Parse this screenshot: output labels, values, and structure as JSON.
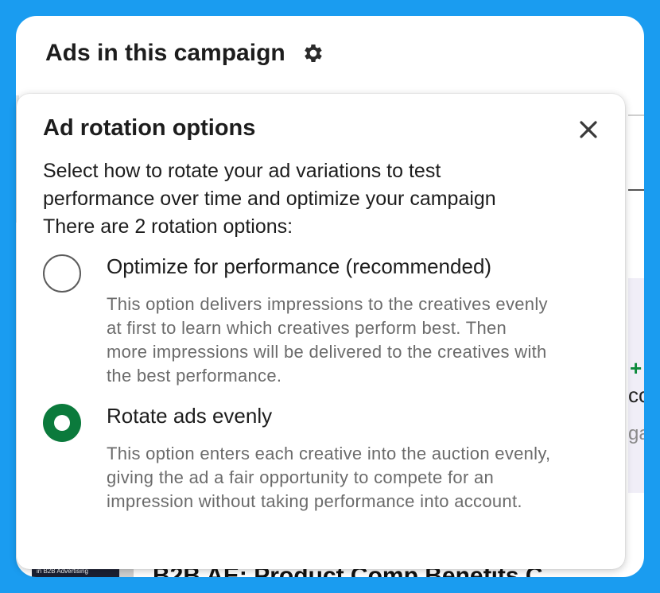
{
  "card": {
    "title": "Ads in this campaign",
    "settings_icon": "gear-icon"
  },
  "background": {
    "plus_glyph": "+",
    "fragment_1": "co",
    "fragment_2": "ga",
    "thumbnail_text": "in B2B Advertising",
    "heading_partial": "B2B AE: Product Comp Benefits C"
  },
  "popover": {
    "title": "Ad rotation options",
    "close_icon": "close-icon",
    "description": "Select how to rotate your ad variations to test performance over time and optimize your campaign There are 2 rotation options:",
    "selected_option": "rotate_evenly",
    "options": [
      {
        "id": "optimize",
        "label": "Optimize for performance (recommended)",
        "description": "This option delivers impressions to the creatives evenly at first to learn which creatives perform best. Then more impressions will be delivered to the creatives with the best performance.",
        "selected": false
      },
      {
        "id": "rotate_evenly",
        "label": "Rotate ads evenly",
        "description": "This option enters each creative into the auction evenly, giving the ad a fair opportunity to compete for an impression without taking performance into account.",
        "selected": true
      }
    ]
  },
  "colors": {
    "page_background": "#1a9cf0",
    "radio_selected": "#0b7a3c",
    "plus_accent": "#0b8a3a"
  }
}
